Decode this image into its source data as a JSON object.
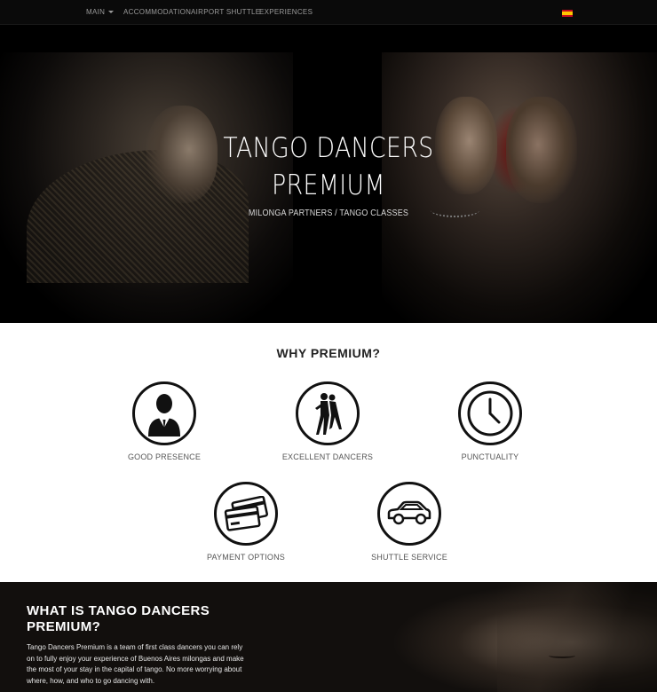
{
  "nav": {
    "items": [
      {
        "label": "MAIN"
      },
      {
        "label": "ACCOMMODATION"
      },
      {
        "label": "AIRPORT SHUTTLE"
      },
      {
        "label": "EXPERIENCES"
      }
    ],
    "language_flag": "flag-es-icon"
  },
  "hero": {
    "title_line1": "TANGO DANCERS",
    "title_line2": "PREMIUM",
    "subtitle": "MILONGA PARTNERS / TANGO CLASSES"
  },
  "why": {
    "title": "WHY PREMIUM?",
    "features": [
      {
        "label": "GOOD PRESENCE",
        "icon": "businessman-icon"
      },
      {
        "label": "EXCELLENT DANCERS",
        "icon": "tango-couple-icon"
      },
      {
        "label": "PUNCTUALITY",
        "icon": "clock-icon"
      },
      {
        "label": "PAYMENT OPTIONS",
        "icon": "credit-cards-icon"
      },
      {
        "label": "SHUTTLE SERVICE",
        "icon": "car-icon"
      }
    ]
  },
  "what": {
    "title": "WHAT IS TANGO DANCERS PREMIUM?",
    "text": "Tango Dancers Premium is a team of first class dancers you can rely on to fully enjoy your experience of Buenos Aires milongas and make the most of your stay in the capital of tango. No more worrying about where, how, and who to go dancing with."
  },
  "colors": {
    "background_dark": "#000000",
    "section_light": "#ffffff",
    "nav_text": "#9a9a9a",
    "flag_red": "#c60b1e",
    "flag_yellow": "#ffc400"
  }
}
